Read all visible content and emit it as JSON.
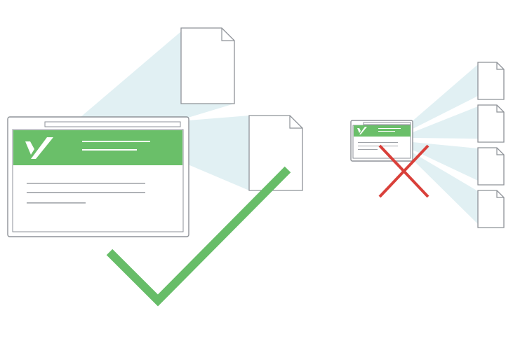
{
  "colors": {
    "background": "#ffffff",
    "beam": "#e1f0f3",
    "outline": "#8e9298",
    "brand_green": "#6abf69",
    "check_green": "#67bd68",
    "cross_red": "#d9403a",
    "text_line": "#9fa3a8",
    "header_line": "#ffffff"
  },
  "icons": {
    "brand_logo": "v-check-logo-icon",
    "document": "document-icon",
    "success_mark": "checkmark-icon",
    "failure_mark": "cross-icon"
  },
  "left_group": {
    "concept": "single-page-multiple-documents",
    "documents_count": 2,
    "result": "check"
  },
  "right_group": {
    "concept": "small-page-many-documents",
    "documents_count": 4,
    "result": "cross"
  }
}
